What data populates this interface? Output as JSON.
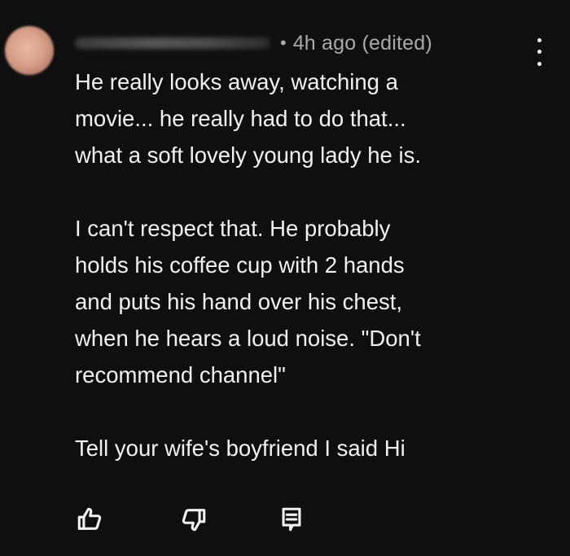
{
  "comment": {
    "timestamp": "4h ago (edited)",
    "separator": "•",
    "paragraphs": [
      {
        "lines": [
          "He really looks away, watching a",
          "movie... he really had to do that...",
          "what a soft lovely young lady he is."
        ]
      },
      {
        "lines": [
          "I can't respect that. He probably",
          "holds his coffee cup with 2 hands",
          "and puts his hand over his chest,",
          "when he hears a loud noise. \"Don't",
          "recommend channel\""
        ]
      },
      {
        "lines": [
          "Tell your wife's boyfriend I said Hi"
        ]
      }
    ]
  },
  "icons": {
    "like": "thumbs-up-icon",
    "dislike": "thumbs-down-icon",
    "reply": "reply-icon",
    "more": "more-vertical-icon"
  },
  "colors": {
    "background": "#0f0f0f",
    "text": "#f1f1f1",
    "meta": "#aaaaaa"
  }
}
